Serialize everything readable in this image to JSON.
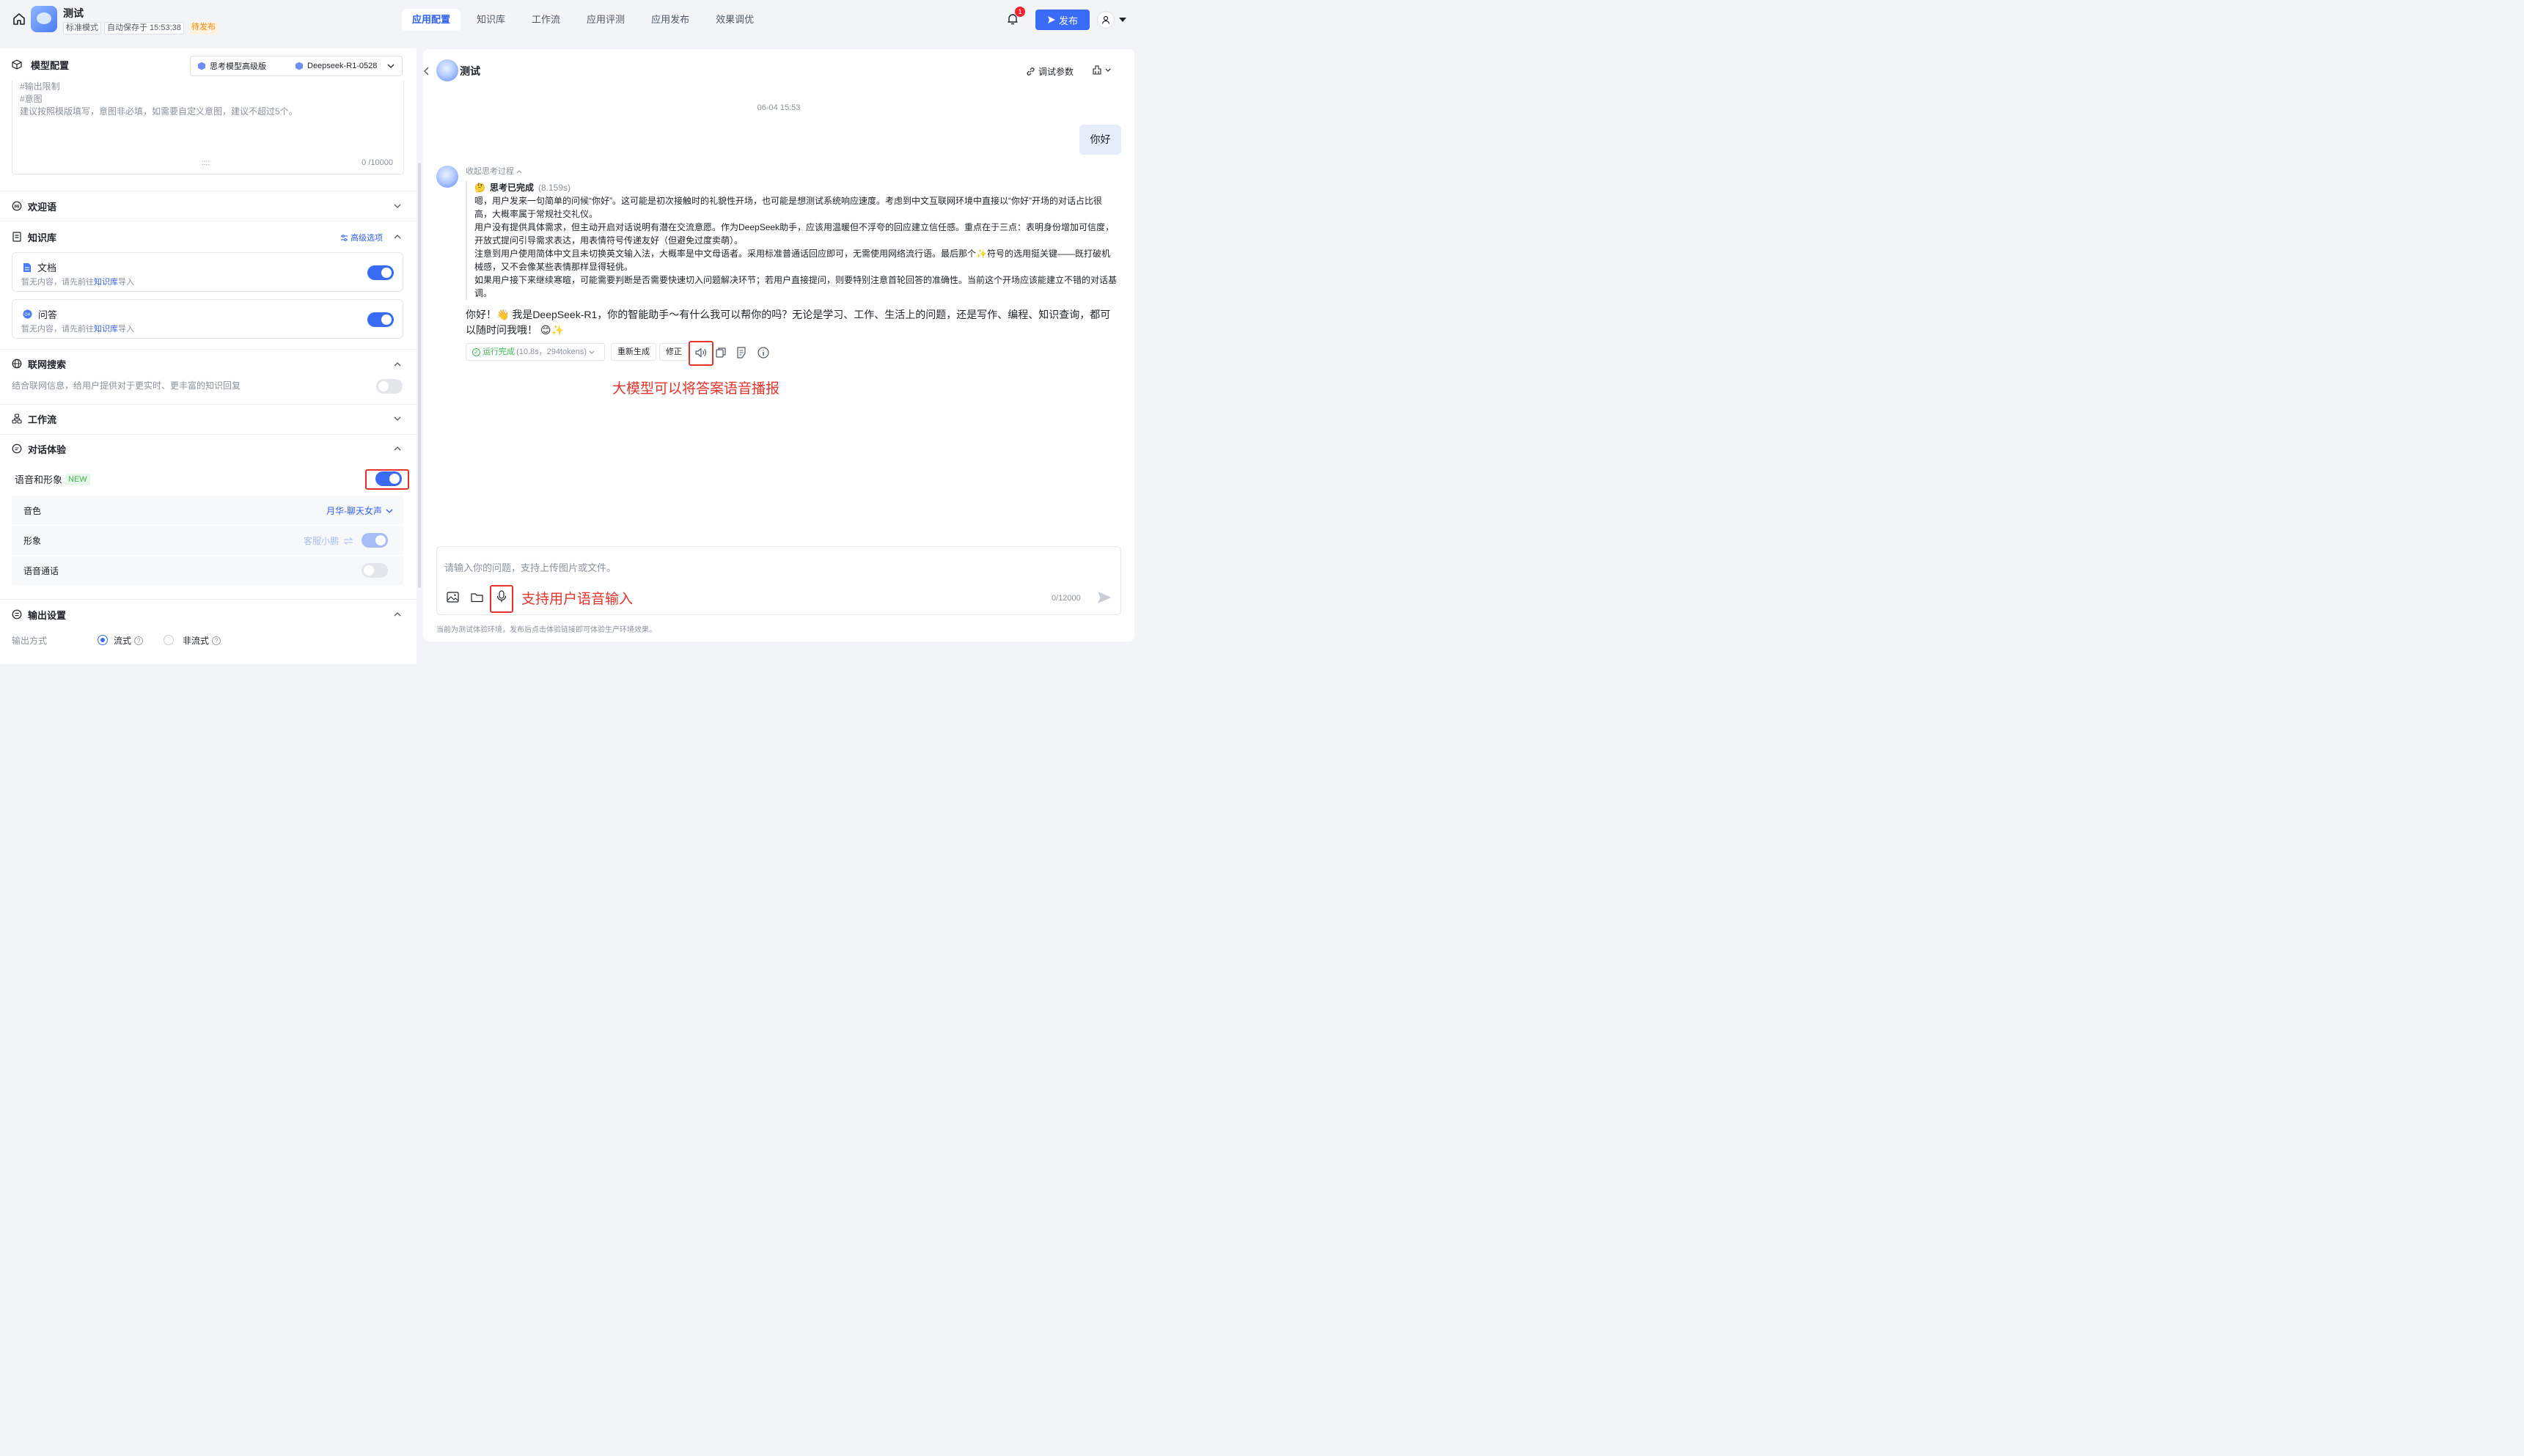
{
  "header": {
    "title": "测试",
    "mode_tag": "标准模式",
    "autosave": "自动保存于 15:53:38",
    "status": "待发布",
    "tabs": [
      {
        "label": "应用配置",
        "active": true
      },
      {
        "label": "知识库"
      },
      {
        "label": "工作流"
      },
      {
        "label": "应用评测"
      },
      {
        "label": "应用发布"
      },
      {
        "label": "效果调优"
      }
    ],
    "notifications": "1",
    "publish_label": "发布"
  },
  "left": {
    "model_config": {
      "title": "模型配置",
      "model_tier": "思考模型高级版",
      "model_name": "Deepseek-R1-0528"
    },
    "prompt": {
      "lines": [
        "#输出限制",
        "#意图",
        "建议按照模版填写，意图非必填，如需要自定义意图，建议不超过5个。"
      ],
      "counter": "0 /10000",
      "resize_handle": "::::"
    },
    "welcome": {
      "title": "欢迎语"
    },
    "knowledge": {
      "title": "知识库",
      "advanced": "高级选项",
      "doc": {
        "title": "文档",
        "sub_pre": "暂无内容，请先前往",
        "sub_link": "知识库",
        "sub_post": "导入"
      },
      "qa": {
        "title": "问答",
        "sub_pre": "暂无内容，请先前往",
        "sub_link": "知识库",
        "sub_post": "导入"
      }
    },
    "web_search": {
      "title": "联网搜索",
      "desc": "结合联网信息，给用户提供对于更实时、更丰富的知识回复"
    },
    "workflow": {
      "title": "工作流"
    },
    "dialog": {
      "title": "对话体验",
      "voice_label": "语音和形象",
      "new_tag": "NEW",
      "timbre_label": "音色",
      "timbre_value": "月华-聊天女声",
      "avatar_label": "形象",
      "avatar_value": "客服小鹏",
      "voice_call_label": "语音通话"
    },
    "output": {
      "title": "输出设置",
      "mode_label": "输出方式",
      "stream": "流式",
      "non_stream": "非流式"
    }
  },
  "chat": {
    "title": "测试",
    "debug_params": "调试参数",
    "timestamp": "06-04 15:53",
    "user_message": "你好",
    "collapse_thinking": "收起思考过程",
    "thinking_done": "思考已完成",
    "thinking_time": "(8.159s)",
    "thinking_paragraphs": [
      "嗯，用户发来一句简单的问候“你好”。这可能是初次接触时的礼貌性开场，也可能是想测试系统响应速度。考虑到中文互联网环境中直接以“你好”开场的对话占比很高，大概率属于常规社交礼仪。",
      "用户没有提供具体需求，但主动开启对话说明有潜在交流意愿。作为DeepSeek助手，应该用温暖但不浮夸的回应建立信任感。重点在于三点：表明身份增加可信度，开放式提问引导需求表达，用表情符号传递友好（但避免过度卖萌）。",
      "注意到用户使用简体中文且未切换英文输入法，大概率是中文母语者。采用标准普通话回应即可，无需使用网络流行语。最后那个✨符号的选用挺关键——既打破机械感，又不会像某些表情那样显得轻佻。",
      "如果用户接下来继续寒暄，可能需要判断是否需要快速切入问题解决环节；若用户直接提问，则要特别注意首轮回答的准确性。当前这个开场应该能建立不错的对话基调。"
    ],
    "answer": "你好！👋 我是DeepSeek-R1，你的智能助手～有什么我可以帮你的吗？无论是学习、工作、生活上的问题，还是写作、编程、知识查询，都可以随时问我哦！ 😊✨",
    "run_status": "运行完成",
    "run_stats": "(10.8s，294tokens)",
    "regenerate": "重新生成",
    "fix": "修正",
    "annotation_tts": "大模型可以将答案语音播报",
    "input_placeholder": "请输入你的问题，支持上传图片或文件。",
    "annotation_voice": "支持用户语音输入",
    "char_counter": "0/12000",
    "footer_note": "当前为测试体验环境，发布后点击体验链接即可体验生产环境效果。"
  },
  "colors": {
    "accent": "#3a6bf7",
    "annotation": "#e5332a",
    "status_green": "#3fb950",
    "pending_orange": "#f5860a"
  }
}
